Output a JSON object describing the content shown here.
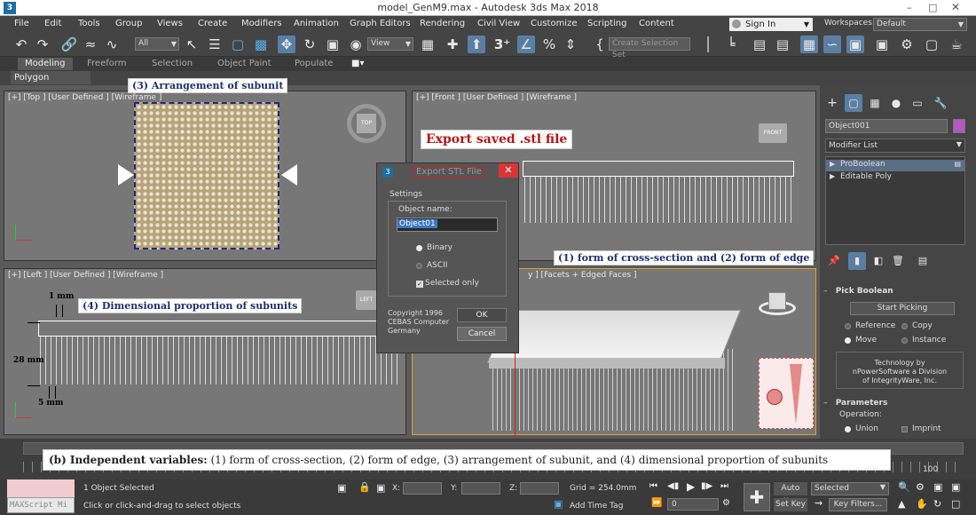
{
  "window": {
    "title": "model_GenM9.max - Autodesk 3ds Max 2018",
    "logo": "3"
  },
  "menus": [
    "File",
    "Edit",
    "Tools",
    "Group",
    "Views",
    "Create",
    "Modifiers",
    "Animation",
    "Graph Editors",
    "Rendering",
    "Civil View",
    "Customize",
    "Scripting",
    "Content"
  ],
  "header_right": {
    "signin": "Sign In",
    "workspaces_label": "Workspaces:",
    "workspace_value": "Default"
  },
  "toolbar": {
    "filter": "All",
    "view": "View",
    "selection_set": "Create Selection Set"
  },
  "ribbon": {
    "tabs": [
      "Modeling",
      "Freeform",
      "Selection",
      "Object Paint",
      "Populate"
    ],
    "sub_label": "Polygon Modeling"
  },
  "viewports": {
    "top": {
      "label": "[+] [Top ] [User Defined ] [Wireframe ]",
      "cube": "TOP"
    },
    "front": {
      "label": "[+] [Front ] [User Defined ] [Wireframe ]",
      "cube": "FRONT"
    },
    "left": {
      "label": "[+] [Left ] [User Defined ] [Wireframe ]",
      "cube": "LEFT"
    },
    "persp": {
      "label": "y ] [Facets + Edged Faces ]"
    }
  },
  "annotations": {
    "arrangement": "(3) Arrangement of subunit",
    "export": "Export saved .stl file",
    "cross_section": "(1) form of cross-section and (2) form of edge",
    "dimensional": "(4) Dimensional proportion of subunits",
    "dim_1mm": "1 mm",
    "dim_28mm": "28 mm",
    "dim_5mm": "5 mm",
    "variables_prefix": "(b) Independent variables:",
    "variables_text": " (1) form of cross-section, (2) form of edge, (3) arrangement of subunit, and (4) dimensional proportion of subunits"
  },
  "export_dialog": {
    "title": "Export STL File",
    "settings": "Settings",
    "object_name_label": "Object name:",
    "object_name_value": "Object01",
    "binary": "Binary",
    "ascii": "ASCII",
    "selected_only": "Selected only",
    "copyright": [
      "Copyright 1996",
      "CEBAS Computer",
      "Germany"
    ],
    "ok": "OK",
    "cancel": "Cancel"
  },
  "command_panel": {
    "object_name": "Object001",
    "modifier_list": "Modifier List",
    "stack": [
      "ProBoolean",
      "Editable Poly"
    ],
    "pick_boolean": "Pick Boolean",
    "start_picking": "Start Picking",
    "radios": [
      "Reference",
      "Copy",
      "Move",
      "Instance"
    ],
    "credit": [
      "Technology by",
      "nPowerSoftware a Division",
      "of IntegrityWare, Inc."
    ],
    "parameters": "Parameters",
    "operation": "Operation:",
    "union": "Union",
    "imprint": "Imprint"
  },
  "timeline": {
    "frame": "100"
  },
  "status": {
    "maxscript": "MAXScript Mi",
    "selected": "1 Object Selected",
    "prompt": "Click or click-and-drag to select objects",
    "x": "X:",
    "y": "Y:",
    "z": "Z:",
    "grid": "Grid = 254.0mm",
    "add_time_tag": "Add Time Tag",
    "auto_key": "Auto Key",
    "set_key": "Set Key",
    "selected_dd": "Selected",
    "key_filters": "Key Filters...",
    "frame_value": "0"
  }
}
